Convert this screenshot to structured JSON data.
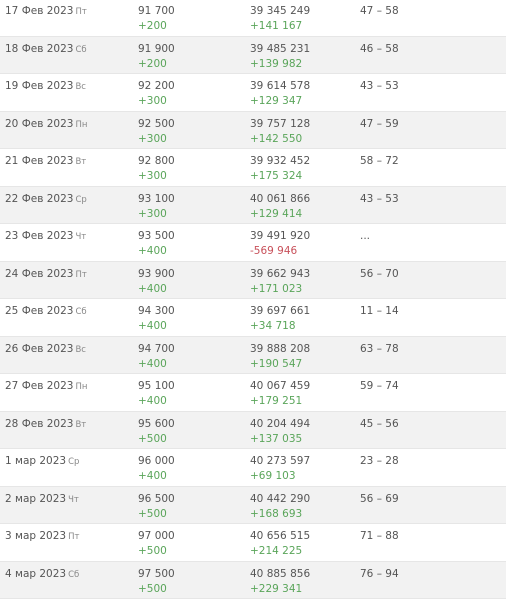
{
  "colors": {
    "positive": "#5aa55a",
    "negative": "#c8505a",
    "row_alt": "#f2f2f2"
  },
  "rows": [
    {
      "date": "17 Фев 2023",
      "weekday": "Пт",
      "value": "91 700",
      "value_delta": "+200",
      "total": "39 345 249",
      "total_delta": "+141 167",
      "range": "47 – 58"
    },
    {
      "date": "18 Фев 2023",
      "weekday": "Сб",
      "value": "91 900",
      "value_delta": "+200",
      "total": "39 485 231",
      "total_delta": "+139 982",
      "range": "46 – 58"
    },
    {
      "date": "19 Фев 2023",
      "weekday": "Вс",
      "value": "92 200",
      "value_delta": "+300",
      "total": "39 614 578",
      "total_delta": "+129 347",
      "range": "43 – 53"
    },
    {
      "date": "20 Фев 2023",
      "weekday": "Пн",
      "value": "92 500",
      "value_delta": "+300",
      "total": "39 757 128",
      "total_delta": "+142 550",
      "range": "47 – 59"
    },
    {
      "date": "21 Фев 2023",
      "weekday": "Вт",
      "value": "92 800",
      "value_delta": "+300",
      "total": "39 932 452",
      "total_delta": "+175 324",
      "range": "58 – 72"
    },
    {
      "date": "22 Фев 2023",
      "weekday": "Ср",
      "value": "93 100",
      "value_delta": "+300",
      "total": "40 061 866",
      "total_delta": "+129 414",
      "range": "43 – 53"
    },
    {
      "date": "23 Фев 2023",
      "weekday": "Чт",
      "value": "93 500",
      "value_delta": "+400",
      "total": "39 491 920",
      "total_delta": "-569 946",
      "range": "..."
    },
    {
      "date": "24 Фев 2023",
      "weekday": "Пт",
      "value": "93 900",
      "value_delta": "+400",
      "total": "39 662 943",
      "total_delta": "+171 023",
      "range": "56 – 70"
    },
    {
      "date": "25 Фев 2023",
      "weekday": "Сб",
      "value": "94 300",
      "value_delta": "+400",
      "total": "39 697 661",
      "total_delta": "+34 718",
      "range": "11 – 14"
    },
    {
      "date": "26 Фев 2023",
      "weekday": "Вс",
      "value": "94 700",
      "value_delta": "+400",
      "total": "39 888 208",
      "total_delta": "+190 547",
      "range": "63 – 78"
    },
    {
      "date": "27 Фев 2023",
      "weekday": "Пн",
      "value": "95 100",
      "value_delta": "+400",
      "total": "40 067 459",
      "total_delta": "+179 251",
      "range": "59 – 74"
    },
    {
      "date": "28 Фев 2023",
      "weekday": "Вт",
      "value": "95 600",
      "value_delta": "+500",
      "total": "40 204 494",
      "total_delta": "+137 035",
      "range": "45 – 56"
    },
    {
      "date": "1 мар 2023",
      "weekday": "Ср",
      "value": "96 000",
      "value_delta": "+400",
      "total": "40 273 597",
      "total_delta": "+69 103",
      "range": "23 – 28"
    },
    {
      "date": "2 мар 2023",
      "weekday": "Чт",
      "value": "96 500",
      "value_delta": "+500",
      "total": "40 442 290",
      "total_delta": "+168 693",
      "range": "56 – 69"
    },
    {
      "date": "3 мар 2023",
      "weekday": "Пт",
      "value": "97 000",
      "value_delta": "+500",
      "total": "40 656 515",
      "total_delta": "+214 225",
      "range": "71 – 88"
    },
    {
      "date": "4 мар 2023",
      "weekday": "Сб",
      "value": "97 500",
      "value_delta": "+500",
      "total": "40 885 856",
      "total_delta": "+229 341",
      "range": "76 – 94"
    }
  ]
}
